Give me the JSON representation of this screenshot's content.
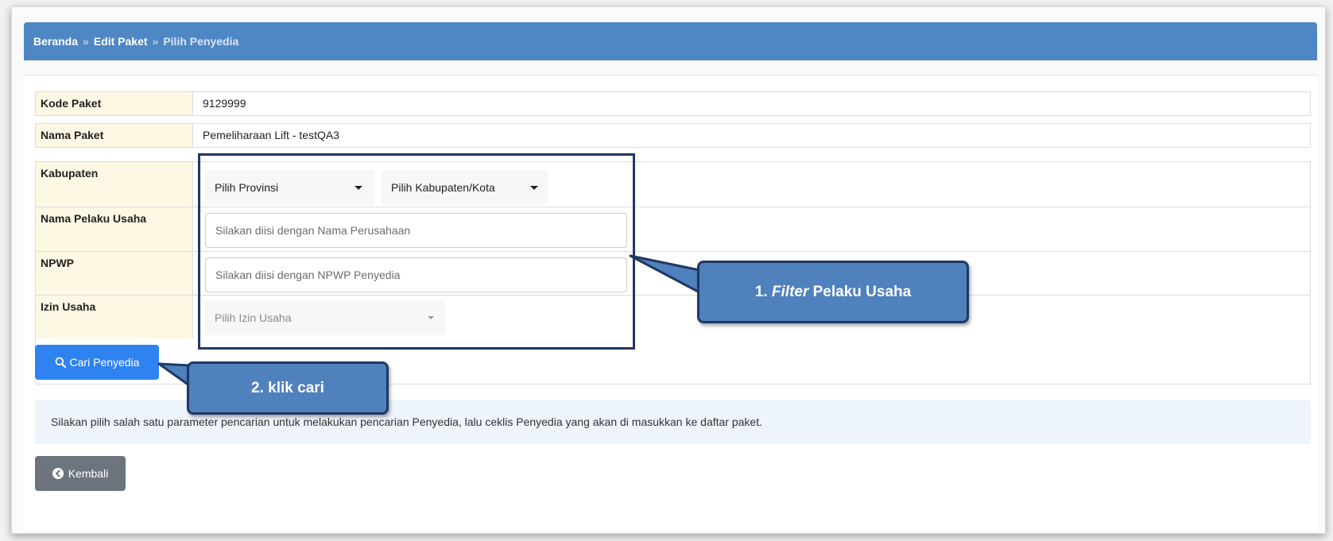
{
  "breadcrumb": {
    "items": [
      "Beranda",
      "Edit Paket",
      "Pilih Penyedia"
    ],
    "separator": "»"
  },
  "package": {
    "kode_label": "Kode Paket",
    "kode_value": "9129999",
    "nama_label": "Nama Paket",
    "nama_value": "Pemeliharaan Lift - testQA3"
  },
  "filters": {
    "kabupaten_label": "Kabupaten",
    "provinsi_select": "Pilih Provinsi",
    "kabupaten_select": "Pilih Kabupaten/Kota",
    "nama_label": "Nama Pelaku Usaha",
    "nama_placeholder": "Silakan diisi dengan Nama Perusahaan",
    "npwp_label": "NPWP",
    "npwp_placeholder": "Silakan diisi dengan NPWP Penyedia",
    "izin_label": "Izin Usaha",
    "izin_select": "Pilih Izin Usaha"
  },
  "buttons": {
    "search_label": "Cari Penyedia",
    "back_label": "Kembali"
  },
  "info_text": "Silakan pilih salah satu parameter pencarian untuk melakukan pencarian Penyedia, lalu ceklis Penyedia yang akan di masukkan ke daftar paket.",
  "annotations": {
    "callout1_prefix": "1. ",
    "callout1_italic": "Filter",
    "callout1_suffix": " Pelaku Usaha",
    "callout2": "2. klik cari"
  },
  "colors": {
    "header_bar": "#4f87c5",
    "label_bg": "#fcf8e3",
    "primary_button": "#2f83f0",
    "secondary_button": "#6c757d",
    "callout_fill": "#4f81bd",
    "callout_border": "#1f3864"
  },
  "icons": {
    "search": "search-icon",
    "back": "arrow-circle-left-icon",
    "dropdown": "caret-down-icon"
  }
}
